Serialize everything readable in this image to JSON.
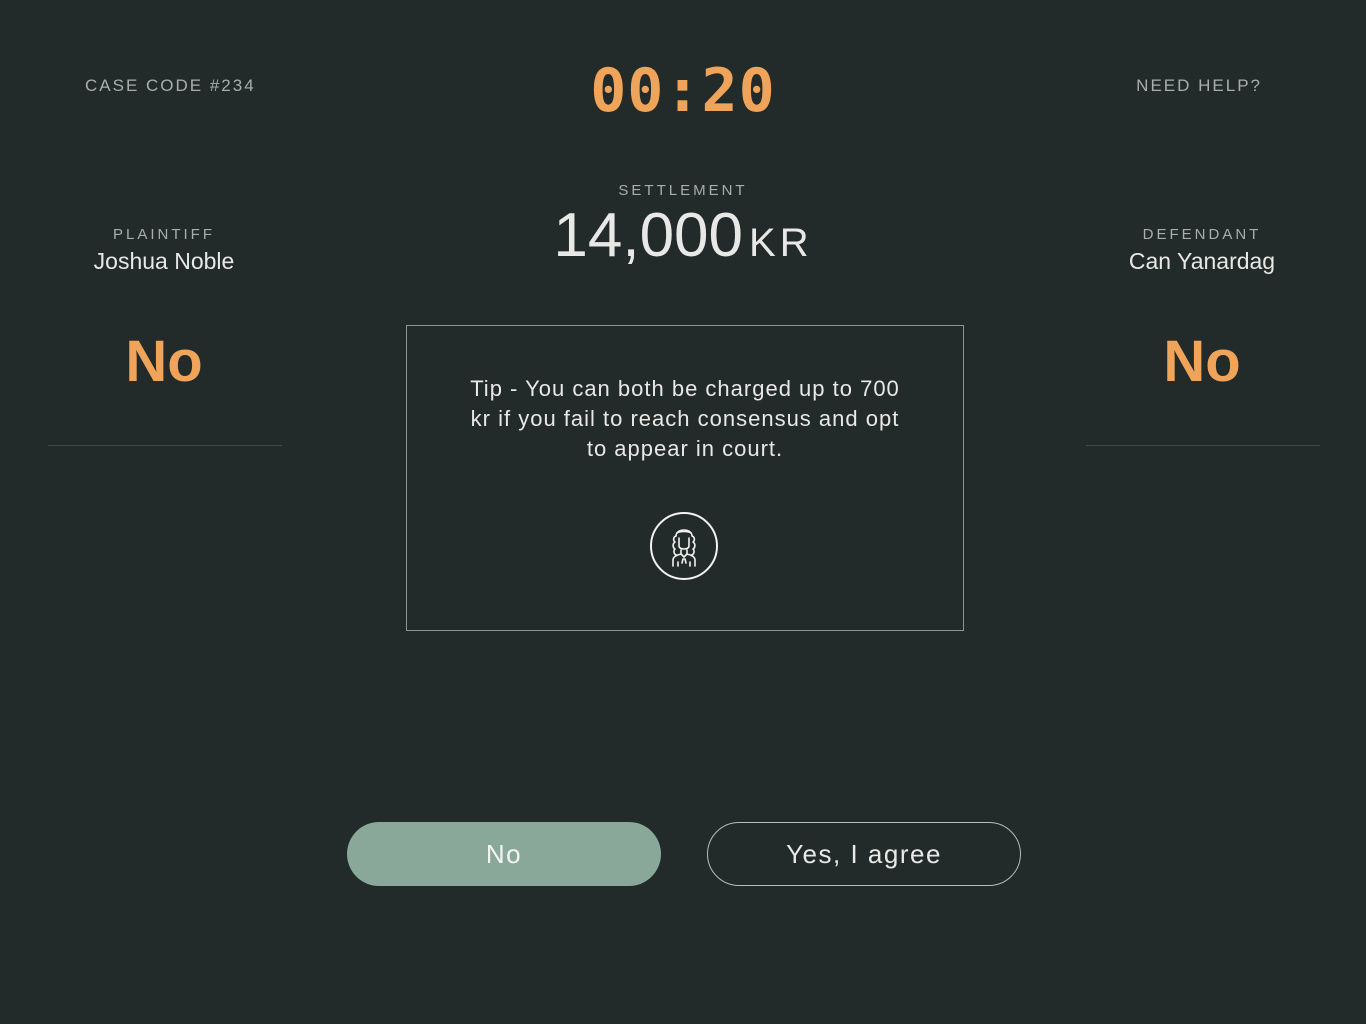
{
  "header": {
    "case_code": "CASE CODE #234",
    "timer": "00:20",
    "help_label": "NEED HELP?"
  },
  "settlement": {
    "label": "SETTLEMENT",
    "amount": "14,000",
    "currency": "KR"
  },
  "plaintiff": {
    "role": "PLAINTIFF",
    "name": "Joshua Noble",
    "vote": "No"
  },
  "defendant": {
    "role": "DEFENDANT",
    "name": "Can Yanardag",
    "vote": "No"
  },
  "tip": {
    "text": "Tip - You can both be charged up to 700 kr if you fail to reach consensus and opt to appear in court.",
    "icon": "judge-icon"
  },
  "actions": {
    "no_label": "No",
    "yes_label": "Yes, I agree"
  },
  "colors": {
    "background": "#232a2a",
    "accent": "#f0a45a",
    "primary_button": "#8aa89a"
  }
}
